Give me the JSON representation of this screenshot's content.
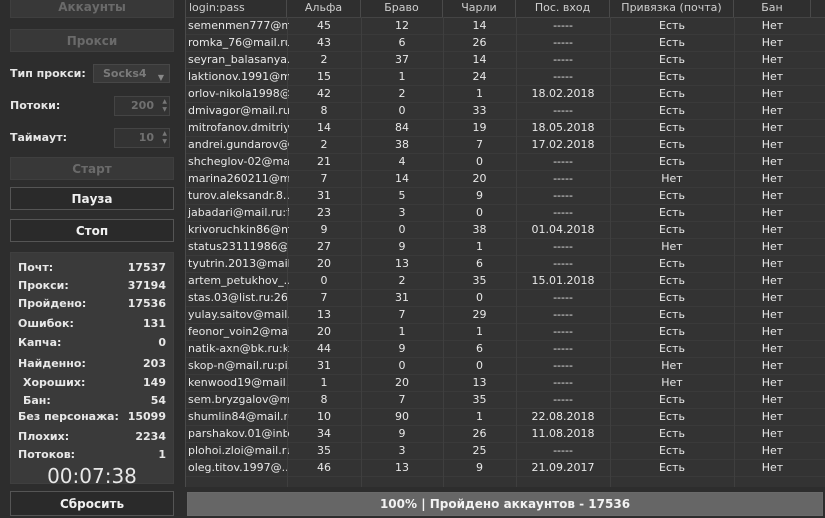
{
  "left": {
    "accounts_button": "Аккаунты",
    "proxy_button": "Прокси",
    "proxy_type_label": "Тип прокси:",
    "proxy_type_value": "Socks4",
    "threads_label": "Потоки:",
    "threads_value": "200",
    "timeout_label": "Таймаут:",
    "timeout_value": "10",
    "start_button": "Старт",
    "pause_button": "Пауза",
    "stop_button": "Стоп",
    "reset_button": "Сбросить"
  },
  "stats": [
    {
      "label": "Почт:",
      "value": "17537"
    },
    {
      "label": "Прокси:",
      "value": "37194"
    },
    {
      "label": "Пройдено:",
      "value": "17536"
    },
    {
      "label": "Ошибок:",
      "value": "131"
    },
    {
      "label": "Капча:",
      "value": "0"
    },
    {
      "label": "Найденно:",
      "value": "203"
    },
    {
      "label": "Хороших:",
      "value": "149"
    },
    {
      "label": "Бан:",
      "value": "54"
    },
    {
      "label": "Без персонажа:",
      "value": "15099"
    },
    {
      "label": "Плохих:",
      "value": "2234"
    },
    {
      "label": "Потоков:",
      "value": "1"
    }
  ],
  "timer": "00:07:38",
  "table": {
    "headers": [
      "login:pass",
      "Альфа",
      "Браво",
      "Чарли",
      "Пос. вход",
      "Привязка (почта)",
      "Бан"
    ],
    "rows": [
      [
        "semenmen777@m...",
        "45",
        "12",
        "14",
        "-----",
        "Есть",
        "Нет"
      ],
      [
        "romka_76@mail.ru...",
        "43",
        "6",
        "26",
        "-----",
        "Есть",
        "Нет"
      ],
      [
        "seyran_balasanya...",
        "2",
        "37",
        "14",
        "-----",
        "Есть",
        "Нет"
      ],
      [
        "laktionov.1991@m...",
        "15",
        "1",
        "24",
        "-----",
        "Есть",
        "Нет"
      ],
      [
        "orlov-nikola1998@...",
        "42",
        "2",
        "1",
        "18.02.2018",
        "Есть",
        "Нет"
      ],
      [
        "dmivagor@mail.ru:...",
        "8",
        "0",
        "33",
        "-----",
        "Есть",
        "Нет"
      ],
      [
        "mitrofanov.dmitriy...",
        "14",
        "84",
        "19",
        "18.05.2018",
        "Есть",
        "Нет"
      ],
      [
        "andrei.gundarov@...",
        "2",
        "38",
        "7",
        "17.02.2018",
        "Есть",
        "Нет"
      ],
      [
        "shcheglov-02@mai...",
        "21",
        "4",
        "0",
        "-----",
        "Есть",
        "Нет"
      ],
      [
        "marina260211@m...",
        "7",
        "14",
        "20",
        "-----",
        "Нет",
        "Нет"
      ],
      [
        "turov.aleksandr.8...",
        "31",
        "5",
        "9",
        "-----",
        "Есть",
        "Нет"
      ],
      [
        "jabadari@mail.ru:f...",
        "23",
        "3",
        "0",
        "-----",
        "Есть",
        "Нет"
      ],
      [
        "krivoruchkin86@m...",
        "9",
        "0",
        "38",
        "01.04.2018",
        "Есть",
        "Нет"
      ],
      [
        "status23111986@...",
        "27",
        "9",
        "1",
        "-----",
        "Нет",
        "Нет"
      ],
      [
        "tyutrin.2013@mail...",
        "20",
        "13",
        "6",
        "-----",
        "Есть",
        "Нет"
      ],
      [
        "artem_petukhov_...",
        "0",
        "2",
        "35",
        "15.01.2018",
        "Есть",
        "Нет"
      ],
      [
        "stas.03@list.ru:26...",
        "7",
        "31",
        "0",
        "-----",
        "Есть",
        "Нет"
      ],
      [
        "yulay.saitov@mail...",
        "13",
        "7",
        "29",
        "-----",
        "Есть",
        "Нет"
      ],
      [
        "feonor_voin2@mai...",
        "20",
        "1",
        "1",
        "-----",
        "Есть",
        "Нет"
      ],
      [
        "natik-axn@bk.ru:k...",
        "44",
        "9",
        "6",
        "-----",
        "Есть",
        "Нет"
      ],
      [
        "skop-n@mail.ru:pi...",
        "31",
        "0",
        "0",
        "-----",
        "Нет",
        "Нет"
      ],
      [
        "kenwood19@mail...",
        "1",
        "20",
        "13",
        "-----",
        "Нет",
        "Нет"
      ],
      [
        "sem.bryzgalov@m...",
        "8",
        "7",
        "35",
        "-----",
        "Есть",
        "Нет"
      ],
      [
        "shumlin84@mail.ru...",
        "10",
        "90",
        "1",
        "22.08.2018",
        "Есть",
        "Нет"
      ],
      [
        "parshakov.01@inb...",
        "34",
        "9",
        "26",
        "11.08.2018",
        "Есть",
        "Нет"
      ],
      [
        "plohoi.zloi@mail.ru...",
        "35",
        "3",
        "25",
        "-----",
        "Есть",
        "Нет"
      ],
      [
        "oleg.titov.1997@...",
        "46",
        "13",
        "9",
        "21.09.2017",
        "Есть",
        "Нет"
      ]
    ]
  },
  "progress": {
    "percent": 100,
    "text": "100% | Пройдено аккаунтов - 17536"
  }
}
